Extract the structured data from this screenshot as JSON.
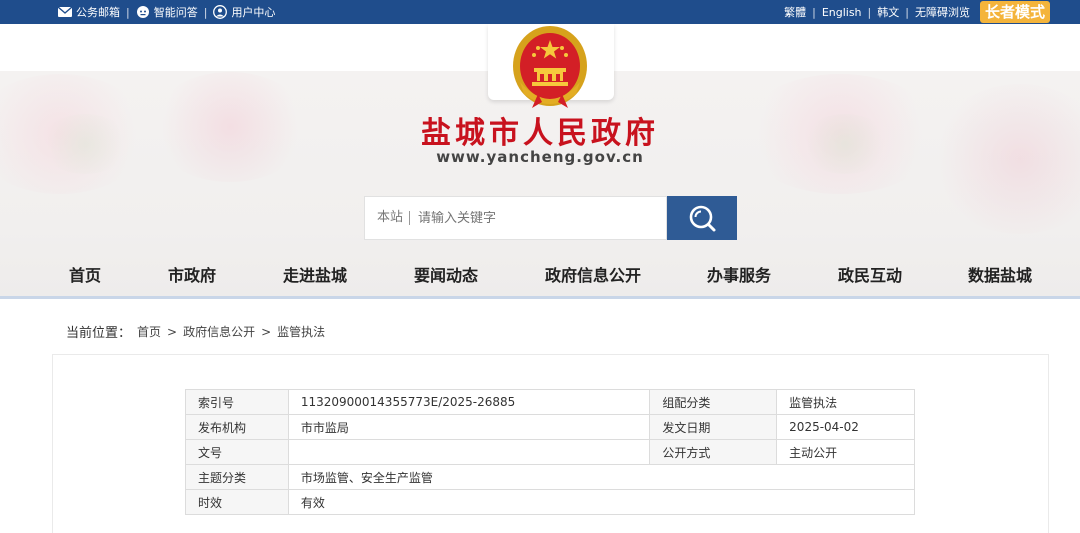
{
  "topbar": {
    "left_items": [
      {
        "label": "公务邮箱",
        "icon": "mail-icon"
      },
      {
        "label": "智能问答",
        "icon": "chat-bot-icon"
      },
      {
        "label": "用户中心",
        "icon": "user-icon"
      }
    ],
    "right_items": [
      "繁體",
      "English",
      "韩文",
      "无障碍浏览"
    ],
    "elder_mode": "长者模式"
  },
  "header": {
    "title": "盐城市人民政府",
    "url": "www.yancheng.gov.cn",
    "emblem": "national-emblem"
  },
  "search": {
    "scope": "本站",
    "placeholder": "请输入关键字",
    "button_icon": "search-icon"
  },
  "nav": {
    "items": [
      "首页",
      "市政府",
      "走进盐城",
      "要闻动态",
      "政府信息公开",
      "办事服务",
      "政民互动",
      "数据盐城"
    ]
  },
  "breadcrumb": {
    "label": "当前位置：",
    "items": [
      "首页",
      "政府信息公开",
      "监管执法"
    ],
    "separator": ">"
  },
  "info": {
    "index_label": "索引号",
    "index_value": "11320900014355773E/2025-26885",
    "category_label": "组配分类",
    "category_value": "监管执法",
    "publisher_label": "发布机构",
    "publisher_value": "市市监局",
    "date_label": "发文日期",
    "date_value": "2025-04-02",
    "docno_label": "文号",
    "docno_value": "",
    "open_label": "公开方式",
    "open_value": "主动公开",
    "topic_label": "主题分类",
    "topic_value": "市场监管、安全生产监管",
    "validity_label": "时效",
    "validity_value": "有效"
  },
  "colors": {
    "topbar": "#1f4d8c",
    "title_red": "#c8121e",
    "search_button": "#2f5b95",
    "elder_button": "#f4b43b"
  }
}
